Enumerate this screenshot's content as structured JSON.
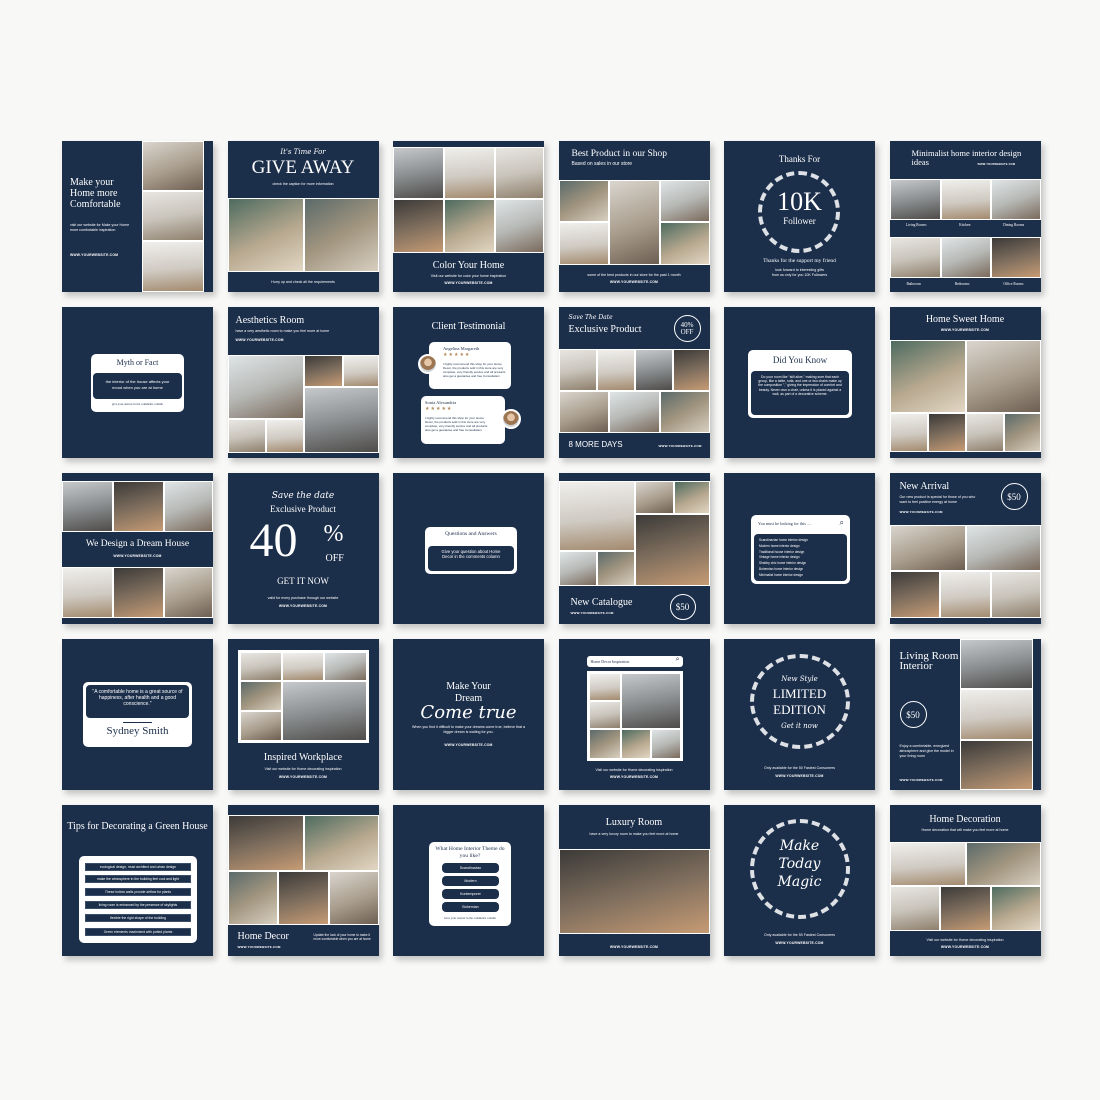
{
  "colors": {
    "background": "#f8f8f7",
    "navy": "#1b2e4a",
    "white": "#ffffff",
    "star": "#b08a5a"
  },
  "website": "WWW.YOURWEBSITE.COM",
  "tiles": {
    "t1": {
      "title": "Make your Home more Comfortable",
      "body": "visit our website for Make your Home more comfortable inspiration"
    },
    "t2": {
      "kicker": "It's Time For",
      "title": "GIVE AWAY",
      "sub": "check the caption for more information",
      "footer": "Hurry up and check all the requirements"
    },
    "t3": {
      "title": "Color Your Home",
      "sub": "Visit our website for color your home inspiration"
    },
    "t4": {
      "title": "Best Product in our Shop",
      "sub": "Based on sales in our store",
      "footer": "some of the best products in our store for the past 1 month"
    },
    "t5": {
      "kicker": "Thanks For",
      "big": "10K",
      "big2": "Follower",
      "line": "Thanks for the support my friend",
      "sub1": "look forward to interesting gifts",
      "sub2": "from us only for you 10K Followers"
    },
    "t6": {
      "title": "Minimalist home interior design ideas",
      "labels": [
        "Living Rooms",
        "Kitchen",
        "Dining Rooms",
        "Bathroom",
        "Bedrooms",
        "Office Rooms"
      ]
    },
    "t7": {
      "title": "Myth or Fact",
      "body": "the interior of the house affects your mood when you are at home",
      "footer": "give your answer in the comments column"
    },
    "t8": {
      "title": "Aesthetics Room",
      "sub": "have a very aesthetic room to make you feel more at home"
    },
    "t9": {
      "title": "Client Testimonial",
      "reviews": [
        {
          "name": "Angelina Margareth",
          "stars": "★★★★★",
          "rating": 5,
          "text": "I highly recommend this shop for your Home Decor, the products sold in this store are very complete, very friendly service and all products also get a guarantee and free Consultation"
        },
        {
          "name": "Sonia Alexandria",
          "stars": "★★★★★",
          "rating": 5,
          "text": "I highly recommend this shop for your Home Decor, the products sold in this store are very complete, very friendly service and all products also get a guarantee and free Consultation"
        }
      ]
    },
    "t10": {
      "kicker": "Save The Date",
      "title": "Exclusive Product",
      "badge1": "40%",
      "badge2": "OFF",
      "footer": "8 MORE DAYS"
    },
    "t11": {
      "title": "Did You Know",
      "body": "Do your room like \"still alive,\" making sure that each group, like a table, sofa, and one or two chairs make up the composition \",\" giving the impression of comfort and beauty. Never own a chair, unless it is placed against a wall, as part of a decorative scheme."
    },
    "t12": {
      "title": "Home Sweet Home"
    },
    "t13": {
      "title": "We Design a Dream House"
    },
    "t14": {
      "kicker": "Save the date",
      "title": "Exclusive Product",
      "big": "40",
      "pct": "%",
      "off": "OFF",
      "cta": "GET IT NOW",
      "sub": "valid for every purchase through our website"
    },
    "t15": {
      "title": "Questions and Answers",
      "body": "Give your question about Home Decor in the comments column"
    },
    "t16": {
      "title": "New Catalogue",
      "price": "$50"
    },
    "t17": {
      "search_placeholder": "You must be looking for this ....",
      "items": [
        "Scandinavian home interior design",
        "Modern home interior design",
        "Traditional house interior design",
        "Vintage home interior design",
        "Shabby chic home interior design",
        "Bohemian home interior design",
        "Minimalist home interior design"
      ]
    },
    "t18": {
      "title": "New Arrival",
      "sub": "Our new product is special for those of you who want to feel positive energy at home",
      "price": "$50"
    },
    "t19": {
      "quote": "\"A comfortable home is a great source of happiness, after health and a good conscience.\"",
      "author": "Sydney Smith"
    },
    "t20": {
      "title": "Inspired Workplace",
      "sub": "Visit our website for Home decorating inspiration"
    },
    "t21": {
      "line1": "Make Your",
      "line2": "Dream",
      "line3": "Come true",
      "sub": "When you find it difficult to make your dreams come true, believe that a bigger dream is waiting for you."
    },
    "t22": {
      "search_value": "Home Decor Inspiration",
      "sub": "Visit our website for Home decorating inspiration"
    },
    "t23": {
      "kicker": "New Style",
      "title1": "LIMITED",
      "title2": "EDITION",
      "cta": "Get it now",
      "sub": "Only available for the 50 Fastest Consumers"
    },
    "t24": {
      "title": "Living Room Interior",
      "price": "$50",
      "body": "Enjoy a comfortable, energized atmosphere and give the model in your living room"
    },
    "t25": {
      "title": "Tips for Decorating a Green House",
      "tips": [
        "ecological design, must architect and urban design",
        "make the atmosphere in the building feel cool and light",
        "These hollow walls provide airflow for plants",
        "living room is enhanced by the presence of skylights",
        "flexible the rigid shape of the building",
        "Green elements maximized with potted plants"
      ]
    },
    "t26": {
      "title": "Home Decor",
      "sub": "Update the look of your home to make it more comfortable when you are at home"
    },
    "t27": {
      "title": "What Home Interior Theme do you like?",
      "options": [
        "Scandinavian",
        "Modern",
        "Kontemporer",
        "Bohemian"
      ],
      "footer": "Give your answer in the comments column"
    },
    "t28": {
      "title": "Luxury Room",
      "sub": "have a very luxury room to make you feel more at home"
    },
    "t29": {
      "line1": "Make",
      "line2": "Today",
      "line3": "Magic",
      "sub": "Only available for the 50 Fastest Consumers"
    },
    "t30": {
      "title": "Home Decoration",
      "sub": "Home decoration that will make you feel more at home",
      "footer": "Visit our website for Home decorating inspiration"
    }
  }
}
